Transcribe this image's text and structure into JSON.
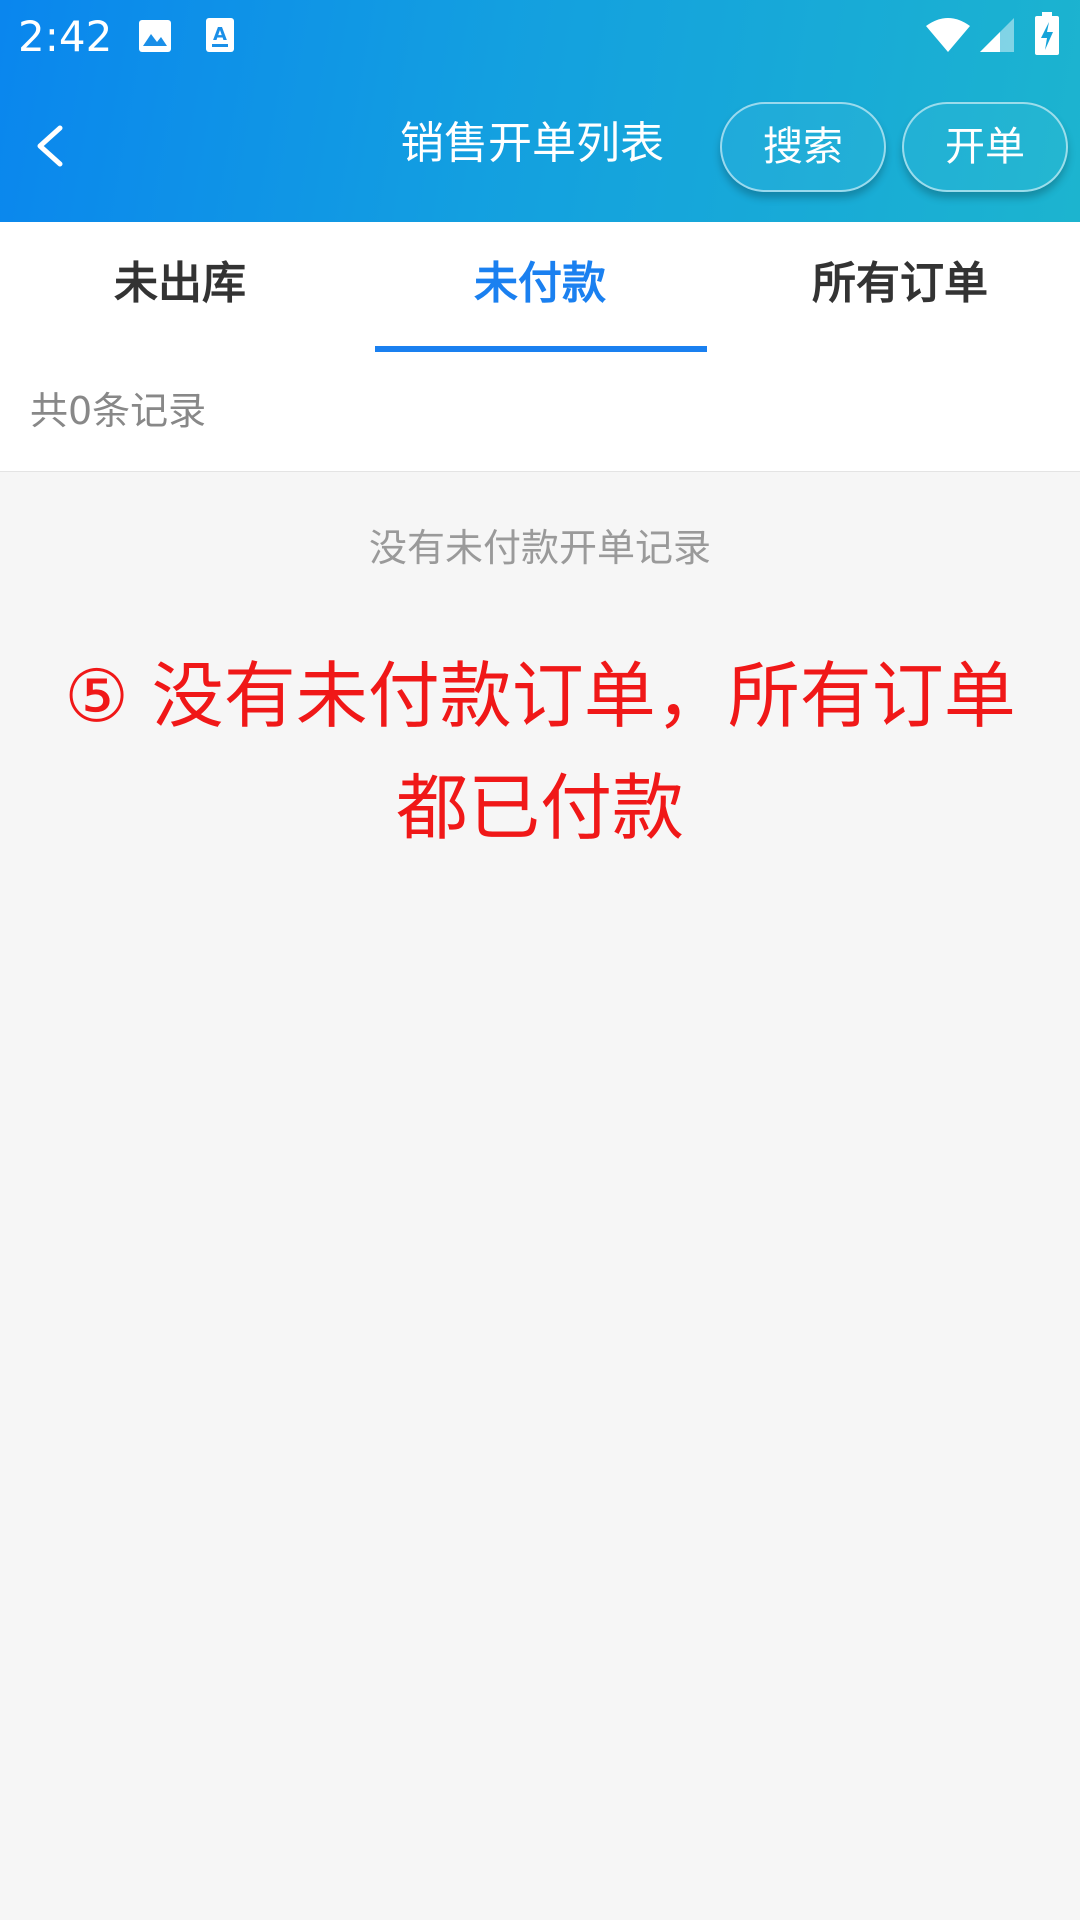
{
  "statusbar": {
    "time": "2:42",
    "icons": [
      "image-icon",
      "a-text-icon",
      "wifi-icon",
      "signal-icon",
      "battery-charging-icon"
    ]
  },
  "header": {
    "back_icon": "back-arrow-icon",
    "title": "销售开单列表",
    "search_label": "搜索",
    "create_label": "开单"
  },
  "tabs": [
    {
      "label": "未出库",
      "active": false
    },
    {
      "label": "未付款",
      "active": true
    },
    {
      "label": "所有订单",
      "active": false
    }
  ],
  "count_text": "共0条记录",
  "empty_message": "没有未付款开单记录",
  "annotation": {
    "line1": "⑤ 没有未付款订单，所有订单",
    "line2": "都已付款"
  },
  "colors": {
    "accent": "#1a80f0",
    "header_start": "#0a86ee",
    "header_end": "#1cb4cf",
    "annotation": "#f01818"
  }
}
